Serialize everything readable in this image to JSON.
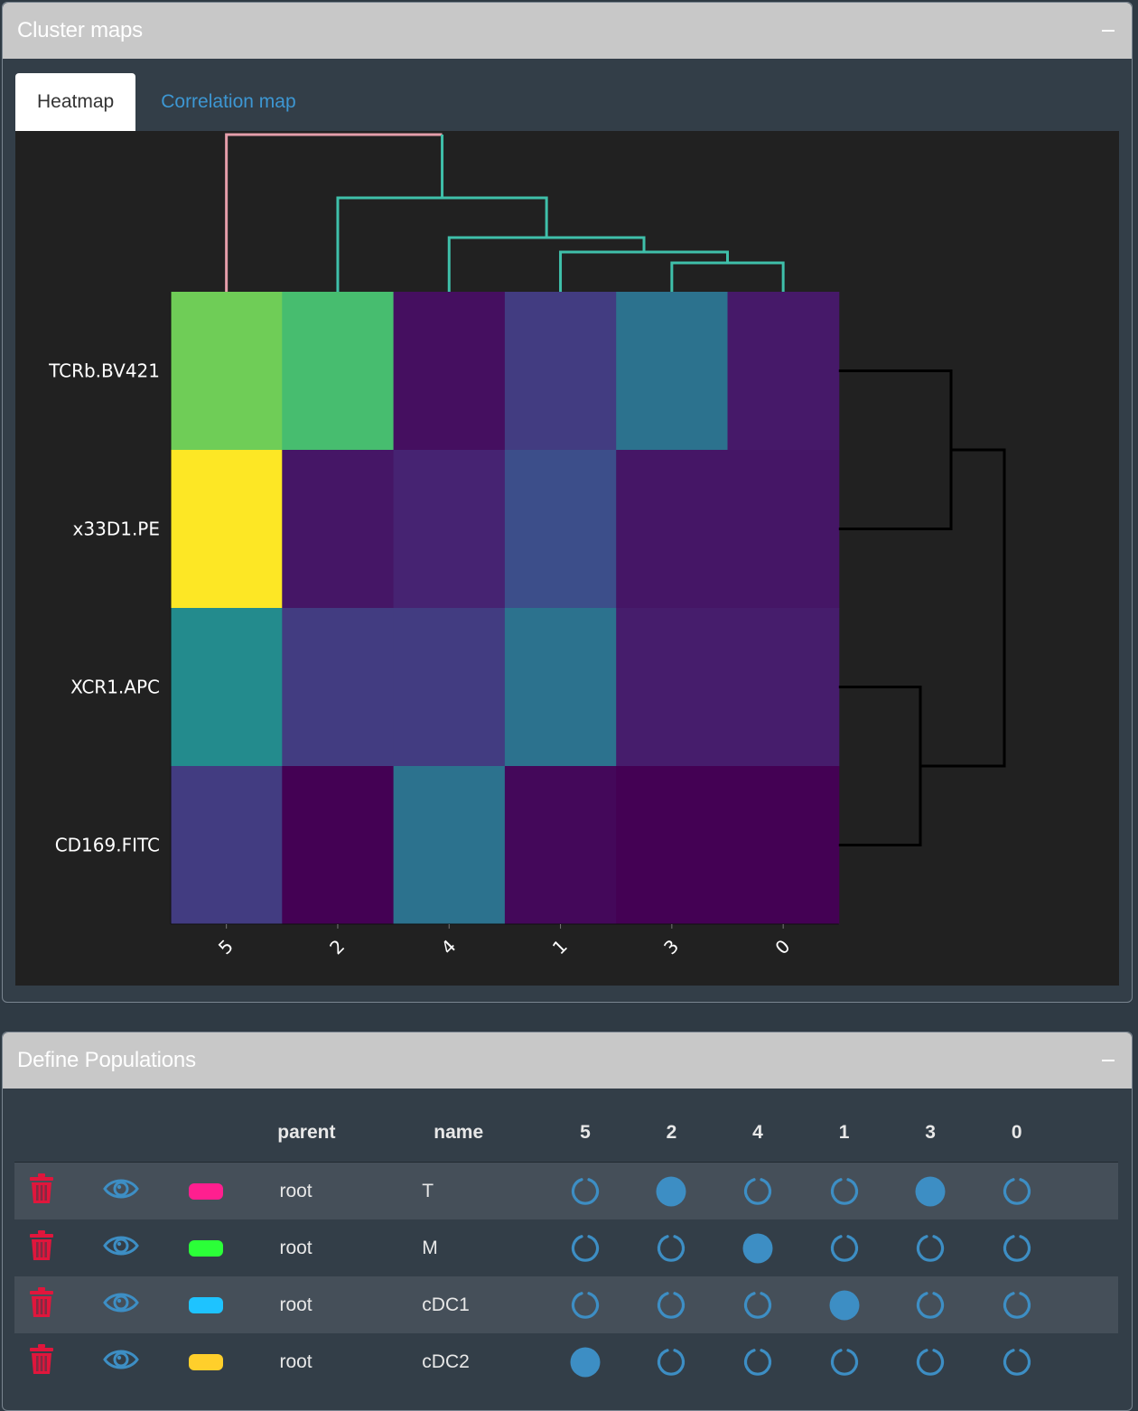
{
  "cluster_panel": {
    "title": "Cluster maps",
    "tabs": [
      {
        "label": "Heatmap",
        "active": true
      },
      {
        "label": "Correlation map",
        "active": false
      }
    ]
  },
  "chart_data": {
    "type": "heatmap",
    "colorscale": "viridis",
    "x": [
      "5",
      "2",
      "4",
      "1",
      "3",
      "0"
    ],
    "y": [
      "TCRb.BV421",
      "x33D1.PE",
      "XCR1.APC",
      "CD169.FITC"
    ],
    "z": [
      [
        0.78,
        0.7,
        0.04,
        0.18,
        0.38,
        0.07
      ],
      [
        1.0,
        0.06,
        0.1,
        0.24,
        0.06,
        0.06
      ],
      [
        0.48,
        0.18,
        0.18,
        0.38,
        0.08,
        0.08
      ],
      [
        0.18,
        0.0,
        0.38,
        0.02,
        0.0,
        0.0
      ]
    ],
    "column_dendrogram_color": [
      "#e59eaa",
      "#3fc0aa"
    ],
    "row_dendrogram_color": "#000000"
  },
  "populations_panel": {
    "title": "Define Populations",
    "columns": {
      "parent": "parent",
      "name": "name",
      "clusters": [
        "5",
        "2",
        "4",
        "1",
        "3",
        "0"
      ]
    },
    "rows": [
      {
        "parent": "root",
        "name": "T",
        "color": "#ff1f8f",
        "selected": [
          false,
          true,
          false,
          false,
          true,
          false
        ]
      },
      {
        "parent": "root",
        "name": "M",
        "color": "#2bff38",
        "selected": [
          false,
          false,
          true,
          false,
          false,
          false
        ]
      },
      {
        "parent": "root",
        "name": "cDC1",
        "color": "#1ec3ff",
        "selected": [
          false,
          false,
          false,
          true,
          false,
          false
        ]
      },
      {
        "parent": "root",
        "name": "cDC2",
        "color": "#ffcf2b",
        "selected": [
          true,
          false,
          false,
          false,
          false,
          false
        ]
      }
    ],
    "icons": {
      "delete": "trash-icon",
      "view": "eye-icon"
    },
    "colors": {
      "delete": "#e0163c",
      "accent": "#3d8ec4"
    }
  }
}
